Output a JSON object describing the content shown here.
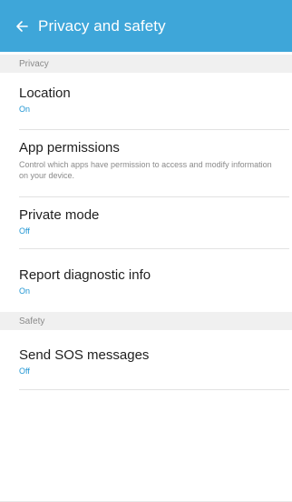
{
  "appbar": {
    "title": "Privacy and safety",
    "back_icon": "arrow-left-icon",
    "background_color": "#3ea6d9"
  },
  "sections": [
    {
      "header": "Privacy",
      "items": [
        {
          "title": "Location",
          "value": "On"
        },
        {
          "title": "App permissions",
          "description": "Control which apps have permission to access and modify information on your device."
        },
        {
          "title": "Private mode",
          "value": "Off"
        },
        {
          "title": "Report diagnostic info",
          "value": "On"
        }
      ]
    },
    {
      "header": "Safety",
      "items": [
        {
          "title": "Send SOS messages",
          "value": "Off"
        }
      ]
    }
  ],
  "colors": {
    "accent": "#2196d3",
    "section_background": "#f0f0f0"
  }
}
